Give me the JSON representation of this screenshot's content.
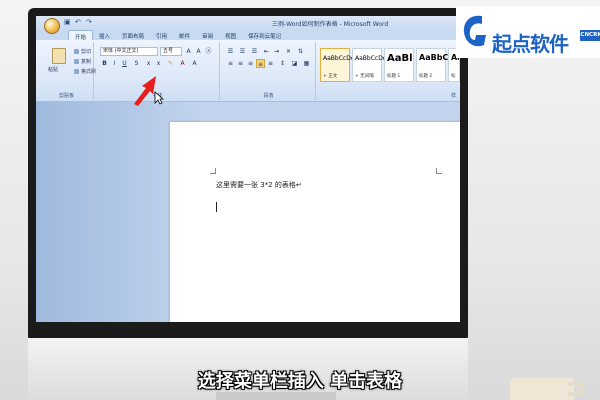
{
  "window": {
    "title": "三例-Word如何制作表格 - Microsoft Word"
  },
  "tabs": [
    {
      "label": "开始",
      "active": true
    },
    {
      "label": "插入",
      "active": false
    },
    {
      "label": "页面布局",
      "active": false
    },
    {
      "label": "引用",
      "active": false
    },
    {
      "label": "邮件",
      "active": false
    },
    {
      "label": "审阅",
      "active": false
    },
    {
      "label": "视图",
      "active": false
    },
    {
      "label": "保存到云笔记",
      "active": false
    }
  ],
  "ribbon": {
    "clipboard": {
      "paste": "粘贴",
      "cut": "剪切",
      "copy": "复制",
      "format_painter": "格式刷",
      "group_label": "剪贴板"
    },
    "font": {
      "font_name": "宋体 (中文正文)",
      "font_size": "五号",
      "group_label": "字体"
    },
    "paragraph": {
      "group_label": "段落"
    },
    "styles": [
      {
        "sample": "AaBbCcDd",
        "name": "+ 正文",
        "selected": true,
        "big": false
      },
      {
        "sample": "AaBbCcDd",
        "name": "+ 无间隔",
        "selected": false,
        "big": false
      },
      {
        "sample": "AaBl",
        "name": "标题 1",
        "selected": false,
        "big": true
      },
      {
        "sample": "AaBbC",
        "name": "标题 2",
        "selected": false,
        "big": true
      },
      {
        "sample": "AaBbC",
        "name": "标",
        "selected": false,
        "big": true
      }
    ],
    "styles_group_label": "样"
  },
  "document": {
    "line1": "这里需要一张 3*2 的表格↵"
  },
  "brand": {
    "logo_text": "起点软件",
    "badge": "CNCRK",
    "color": "#1d63c6"
  },
  "caption": "选择菜单栏插入 单击表格"
}
